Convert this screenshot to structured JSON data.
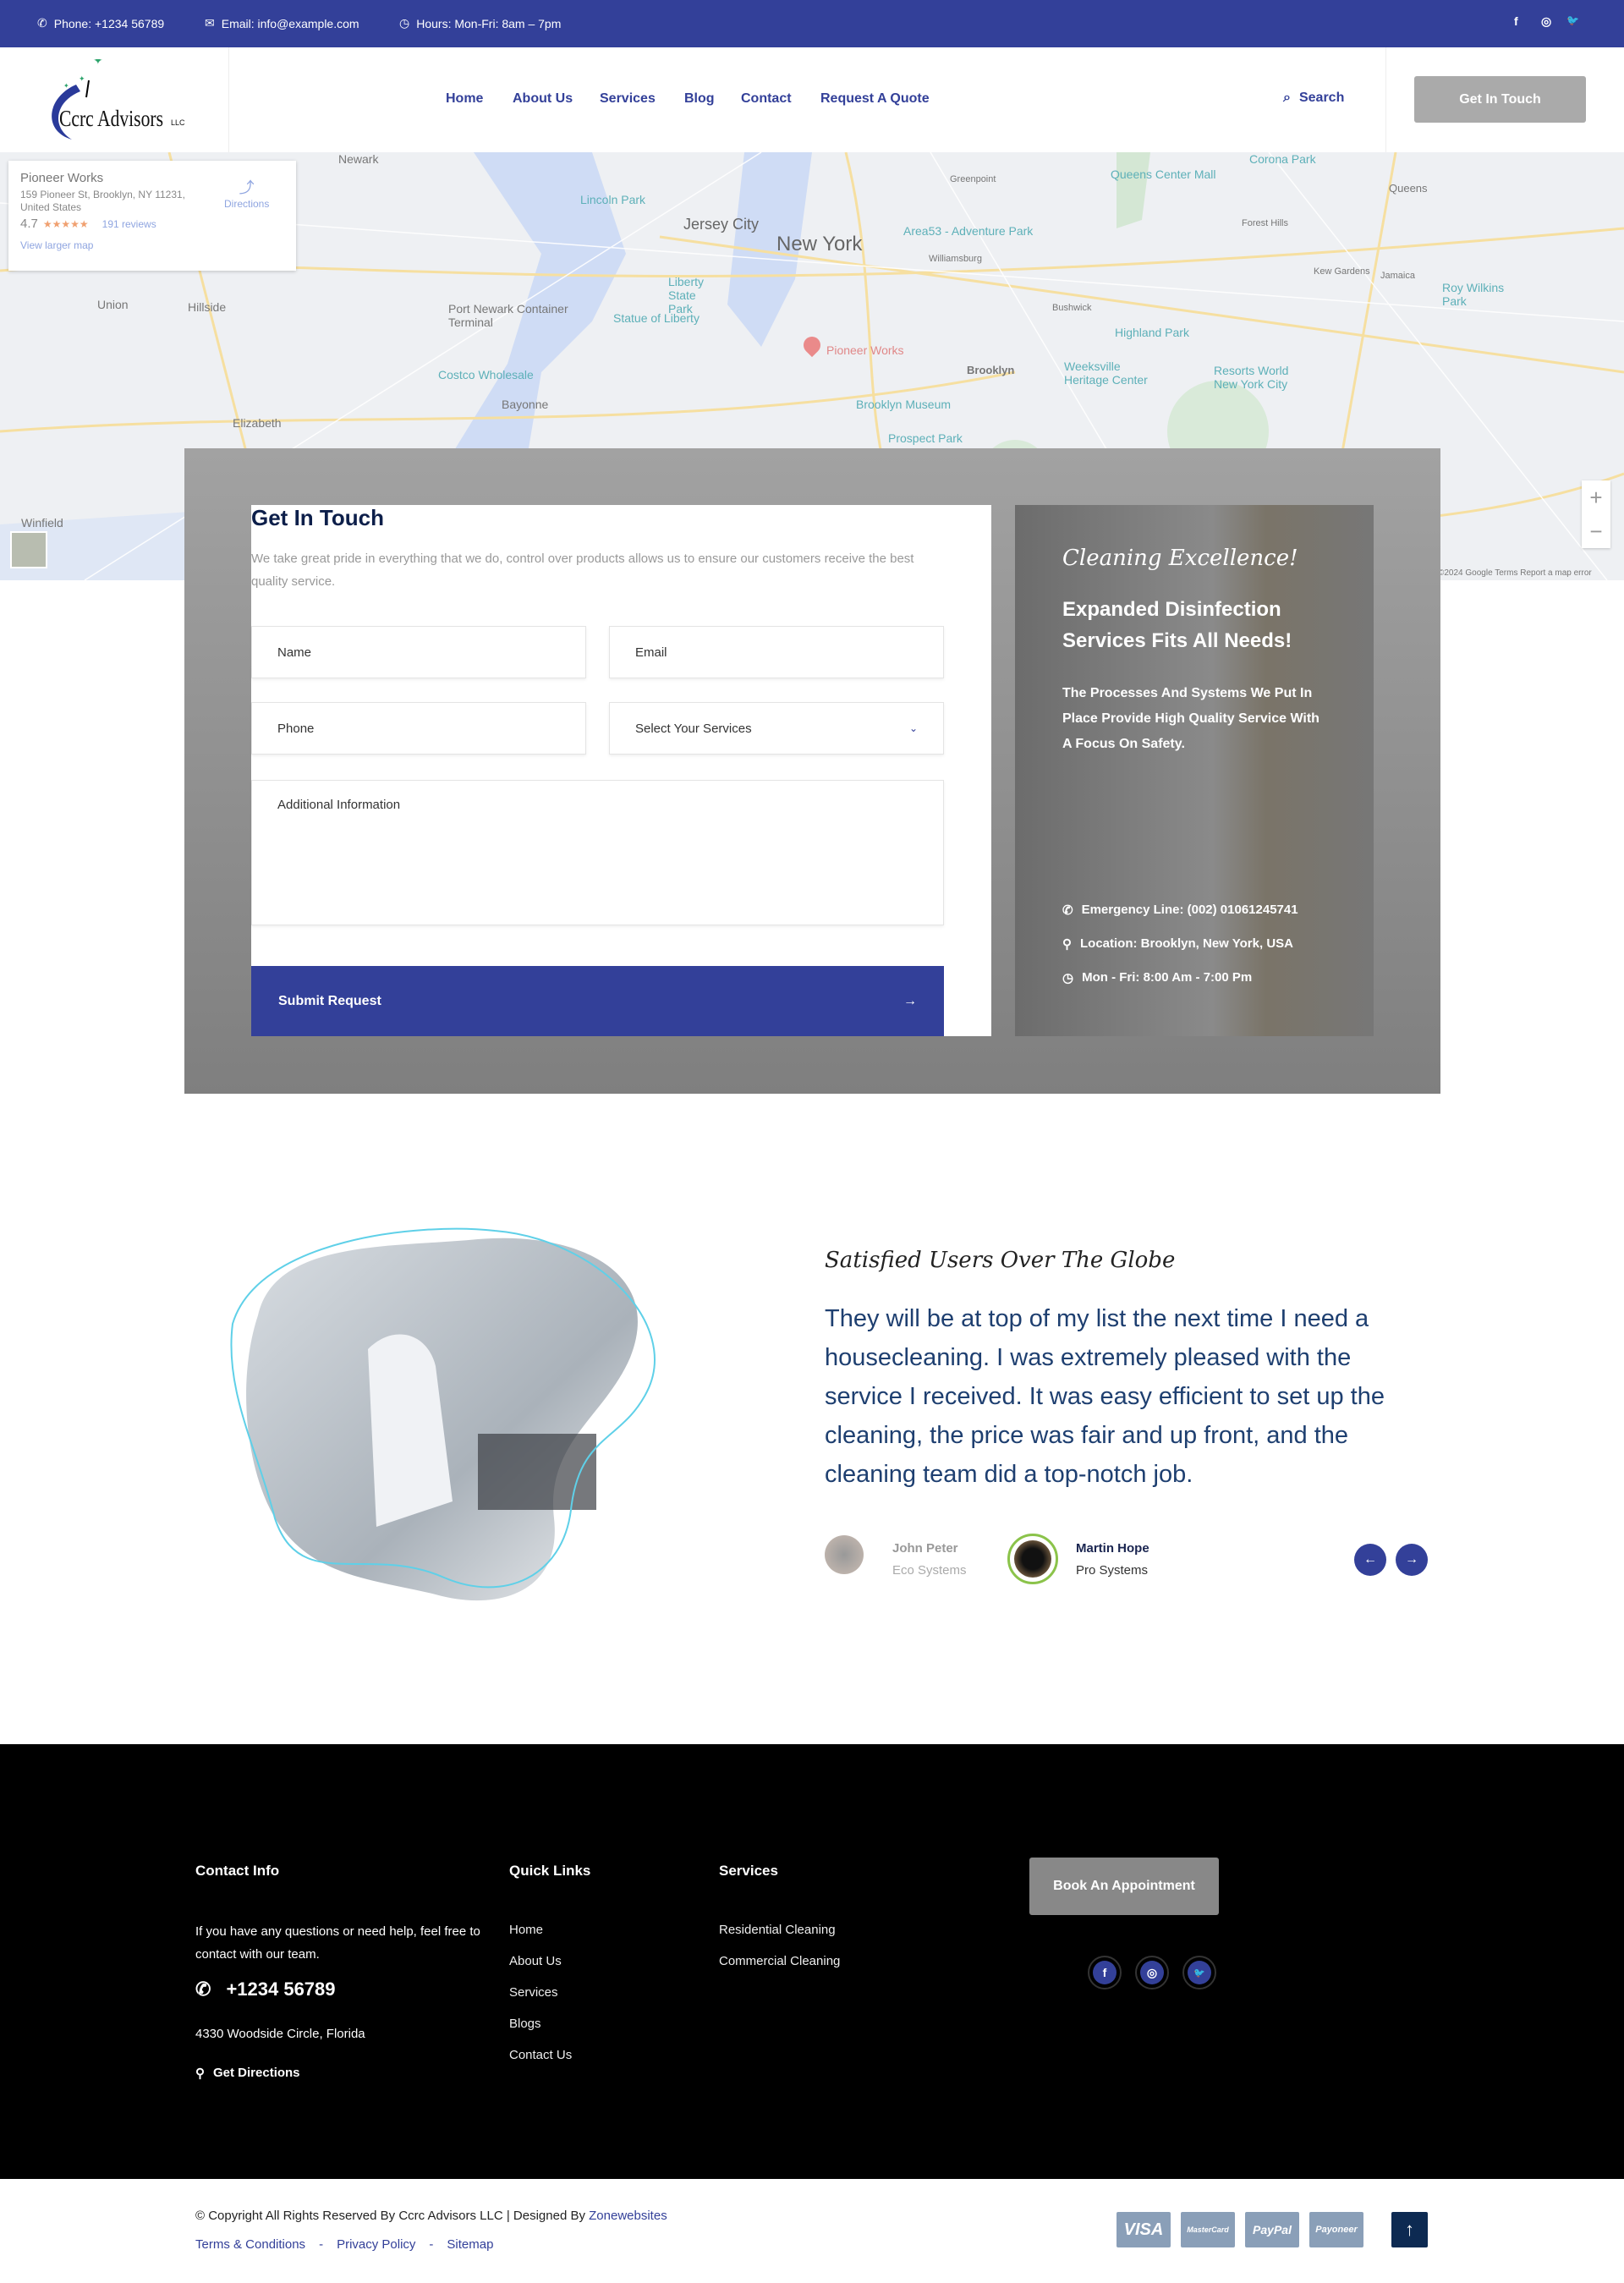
{
  "topbar": {
    "phone": "Phone: +1234 56789",
    "email": "Email: info@example.com",
    "hours": "Hours: Mon-Fri: 8am – 7pm",
    "social": [
      "f",
      "◎",
      "🐦"
    ]
  },
  "header": {
    "logo_text": "Ccrc Advisors",
    "logo_suffix": "LLC",
    "nav": [
      "Home",
      "About Us",
      "Services",
      "Blog",
      "Contact",
      "Request A Quote"
    ],
    "search_label": "Search",
    "cta": "Get In Touch"
  },
  "map": {
    "place_name": "Pioneer Works",
    "address": "159 Pioneer St, Brooklyn, NY 11231, United States",
    "rating": "4.7",
    "stars": "★★★★★",
    "reviews": "191 reviews",
    "directions": "Directions",
    "larger": "View larger map",
    "pin_label": "Pioneer Works",
    "labels": [
      "Newark",
      "Jersey City",
      "New York",
      "Brooklyn",
      "Queens",
      "Bayonne",
      "Union",
      "Hillside",
      "Elizabeth",
      "Lincoln Park",
      "Liberty State Park",
      "Statue of Liberty",
      "Brooklyn Museum",
      "Prospect Park",
      "Highland Park",
      "Queens Center Mall",
      "Corona Park",
      "Forest Hills",
      "Jamaica",
      "Roy Wilkins Park",
      "Area53 - Adventure Park",
      "Weeksville Heritage Center",
      "Resorts World New York City",
      "Costco Wholesale",
      "Winfield",
      "Port Newark Container Terminal",
      "Kew Gardens",
      "Williamsburg",
      "Bushwick",
      "Greenpoint"
    ],
    "footer": "©2024 Google   Terms   Report a map error"
  },
  "form": {
    "title": "Get In Touch",
    "intro": "We take great pride in everything that we do, control over products allows us to ensure our customers receive the best quality service.",
    "name": "Name",
    "email": "Email",
    "phone": "Phone",
    "services": "Select Your Services",
    "info": "Additional Information",
    "submit": "Submit Request"
  },
  "panel": {
    "script": "Cleaning Excellence!",
    "heading": "Expanded Disinfection Services Fits All Needs!",
    "text": "The Processes And Systems We Put In Place Provide High Quality Service With A Focus On Safety.",
    "emergency": "Emergency Line: (002) 01061245741",
    "location": "Location: Brooklyn, New York, USA",
    "hours": "Mon - Fri: 8:00 Am - 7:00 Pm"
  },
  "testimonial": {
    "script": "Satisfied Users Over The Globe",
    "quote": "They will be at top of my list the next time I need a housecleaning. I was extremely pleased with the service I received. It was easy efficient to set up the cleaning, the price was fair and up front, and the cleaning team did a top-notch job.",
    "authors": [
      {
        "name": "John Peter",
        "company": "Eco Systems"
      },
      {
        "name": "Martin Hope",
        "company": "Pro Systems"
      }
    ]
  },
  "footer": {
    "contact_title": "Contact Info",
    "contact_text": "If you have any questions or need help, feel free to contact with our team.",
    "phone": "+1234 56789",
    "address": "4330 Woodside Circle, Florida",
    "directions": "Get Directions",
    "quick_title": "Quick Links",
    "quick": [
      "Home",
      "About Us",
      "Services",
      "Blogs",
      "Contact Us"
    ],
    "services_title": "Services",
    "services": [
      "Residential Cleaning",
      "Commercial Cleaning"
    ],
    "book": "Book An Appointment",
    "social": [
      "f",
      "◎",
      "🐦"
    ]
  },
  "bottom": {
    "copyright": "© Copyright All Rights Reserved By Ccrc Advisors LLC | Designed By ",
    "designer": "Zonewebsites",
    "links": [
      "Terms & Conditions",
      "Privacy Policy",
      "Sitemap"
    ],
    "sep": "-",
    "payments": [
      "VISA",
      "MasterCard",
      "PayPal",
      "Payoneer"
    ]
  },
  "colors": {
    "primary": "#334099",
    "dark": "#0d2a52",
    "gray_button": "#aaaaaa",
    "accent_green": "#8bc34a"
  }
}
